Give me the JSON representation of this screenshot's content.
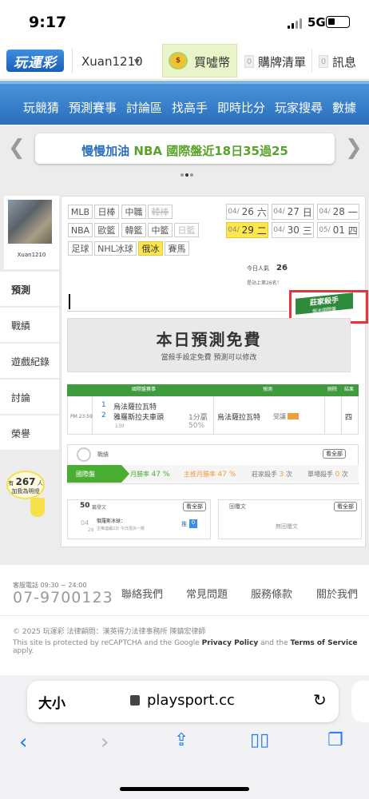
{
  "status_bar": {
    "time": "9:17",
    "network": "5G"
  },
  "header": {
    "logo": "玩運彩",
    "username": "Xuan1210",
    "coin_label": "買噓幣",
    "cart_count": "0",
    "cart_label": "購牌清單",
    "msg_count": "0",
    "msg_label": "訊息"
  },
  "nav": {
    "items": [
      "玩競猜",
      "預測賽事",
      "討論區",
      "找高手",
      "即時比分",
      "玩家搜尋",
      "數據"
    ]
  },
  "banner": {
    "text_prefix": "慢慢加油",
    "text_highlight": "NBA 國際盤近18日35過25"
  },
  "profile": {
    "name": "Xuan1210"
  },
  "sidebar": {
    "items": [
      "預測",
      "戰績",
      "遊戲紀錄",
      "討論",
      "榮譽"
    ]
  },
  "ad": {
    "prefix": "有",
    "count": "267",
    "unit": "人",
    "text": "加我為明燈"
  },
  "leagues": {
    "row1": [
      "MLB",
      "日棒",
      "中職",
      "韓棒"
    ],
    "row2": [
      "NBA",
      "歐籃",
      "韓籃",
      "中籃",
      "日籃"
    ],
    "row3": [
      "足球",
      "NHL冰球",
      "俄冰",
      "賽馬"
    ]
  },
  "dates": [
    {
      "md": "04/",
      "d": "26",
      "w": "六"
    },
    {
      "md": "04/",
      "d": "27",
      "w": "日"
    },
    {
      "md": "04/",
      "d": "28",
      "w": "一"
    },
    {
      "md": "04/",
      "d": "29",
      "w": "二"
    },
    {
      "md": "04/",
      "d": "30",
      "w": "三"
    },
    {
      "md": "05/",
      "d": "01",
      "w": "四"
    }
  ],
  "popularity": {
    "label": "今日人氣",
    "value": "26",
    "rank": "是站上第26名！"
  },
  "pro_badge": {
    "text": "莊家殺手",
    "sub": "俄冰國際盤"
  },
  "free": {
    "title": "本日預測免費",
    "sub": "當殺手設定免費 預測可以修改"
  },
  "table": {
    "headers": {
      "game": "國際盤賽事",
      "pred": "預測",
      "del": "刪除",
      "result": "結果"
    },
    "time": "PM 23:59",
    "num1": "1",
    "team1": "烏法薩拉瓦特",
    "num2": "2",
    "team2": "雅羅斯拉夫車頭",
    "code": "130",
    "line": "1分贏",
    "pct": "50%",
    "pred_team": "烏法薩拉瓦特",
    "pred_status": "受讓",
    "result": "四"
  },
  "stats": {
    "title": "戰績",
    "see_all": "看全部",
    "tab": "國際盤",
    "month_label": "月勝率",
    "month_value": "47 %",
    "main_month_label": "主推月勝率",
    "main_month_value": "47 %",
    "killer_label": "莊家殺手",
    "killer_value": "3",
    "killer_unit": "次",
    "single_label": "單場殺手",
    "single_value": "0",
    "single_unit": "次"
  },
  "posts": {
    "count": "50",
    "label": "篇發文",
    "see_all": "看全部",
    "date_m": "04",
    "date_d": "28",
    "post_title": "俄羅斯冰球：",
    "post_sub": "主推連續2日 今日再拚一場",
    "push": "推",
    "push_count": "0",
    "reply_label": "回覆文",
    "reply_see_all": "看全部",
    "reply_empty": "無回覆文"
  },
  "footer": {
    "phone_label": "客服電話 09:30 ~ 24:00",
    "phone": "07-9700123",
    "links": [
      "聯絡我們",
      "常見問題",
      "服務條款",
      "關於我們"
    ],
    "copyright": "© 2025 玩運彩 法律顧問：漢英得力法律事務所 陳鎮宏律師",
    "recaptcha_pre": "This site is protected by reCAPTCHA and the Google ",
    "privacy": "Privacy Policy",
    "and": " and the ",
    "terms": "Terms of Service",
    "apply": " apply."
  },
  "safari": {
    "text_size": "大小",
    "url": "playsport.cc"
  }
}
